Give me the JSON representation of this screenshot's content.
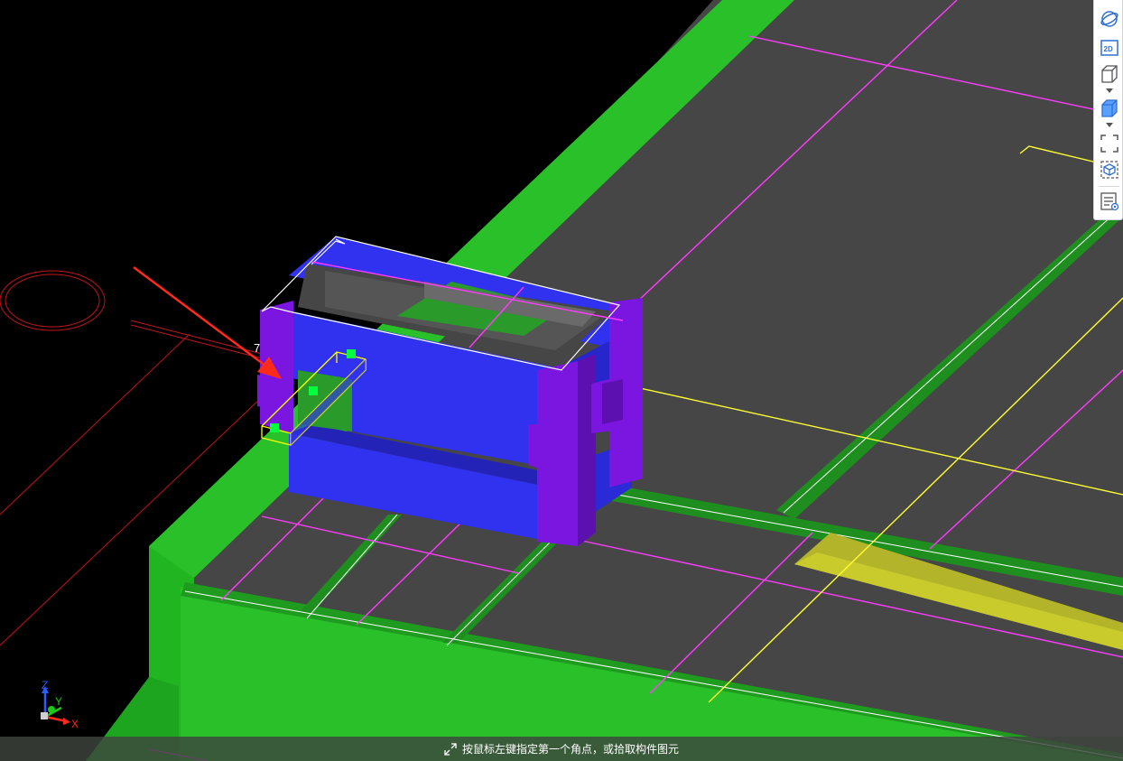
{
  "viewport": {
    "dimension_label": "7",
    "axes": {
      "x": "X",
      "y": "Y",
      "z": "Z"
    }
  },
  "toolbar": {
    "buttons": [
      {
        "name": "dynamic-observe",
        "icon": "orbit-icon"
      },
      {
        "name": "2d-view",
        "icon": "2d-icon",
        "label": "2D"
      },
      {
        "name": "view-direction",
        "icon": "cube-outline-icon"
      },
      {
        "name": "display-mode",
        "icon": "cube-solid-icon"
      },
      {
        "name": "full-screen",
        "icon": "fullscreen-icon"
      },
      {
        "name": "local-3d",
        "icon": "cube-frame-icon"
      },
      {
        "name": "display-settings",
        "icon": "settings-list-icon"
      }
    ]
  },
  "status": {
    "text": "按鼠标左键指定第一个角点，或拾取构件图元",
    "icon": "select-cursor-icon"
  },
  "colors": {
    "background": "#000000",
    "slab": "#464646",
    "beam_green": "#29c02a",
    "beam_green_dark": "#1e9a1f",
    "column_purple": "#7a16e0",
    "box_blue": "#3131f0",
    "grid_magenta": "#ff3cff",
    "axis_yellow": "#ffff33",
    "arrow_red": "#ff2a1a",
    "selection_yellow": "#ffff00",
    "grip_green": "#00ff3c"
  }
}
